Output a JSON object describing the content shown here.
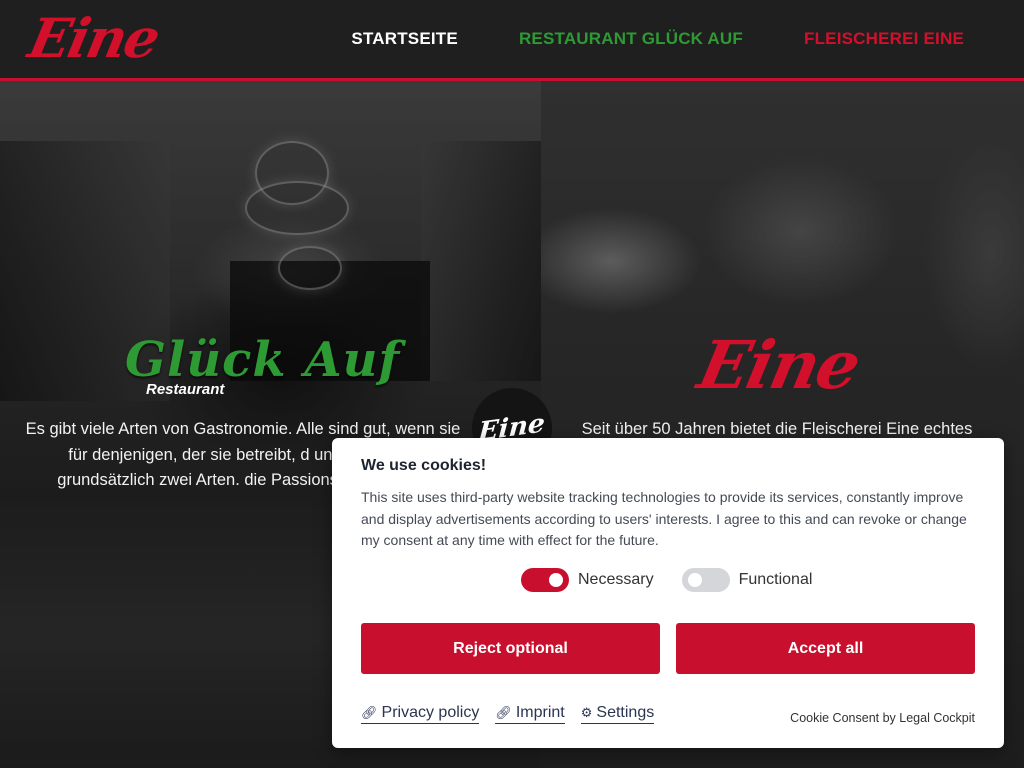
{
  "header": {
    "logo": "Eine",
    "nav": [
      {
        "label": "STARTSEITE",
        "color": "#ffffff"
      },
      {
        "label": "RESTAURANT GLÜCK AUF",
        "color": "#2e9a34"
      },
      {
        "label": "FLEISCHEREI EINE",
        "color": "#d3102b"
      }
    ]
  },
  "left": {
    "title": "Glück Auf",
    "subtitle": "Restaurant",
    "text": "Es gibt viele Arten von Gastronomie. Alle sind gut, wenn sie für denjenigen, der sie betreibt, d unterscheiden grundsätzlich zwei Arten. die Passions-Gastronomi"
  },
  "badge": {
    "logo": "Eine"
  },
  "right": {
    "logo": "Eine",
    "text": "Seit über 50 Jahren bietet die Fleischerei Eine echtes"
  },
  "cookie": {
    "title": "We use cookies!",
    "description": "This site uses third-party website tracking technologies to provide its services, constantly improve and display advertisements according to users' interests. I agree to this and can revoke or change my consent at any time with effect for the future.",
    "toggles": [
      {
        "label": "Necessary",
        "on": true
      },
      {
        "label": "Functional",
        "on": false
      }
    ],
    "reject_label": "Reject optional",
    "accept_label": "Accept all",
    "links": {
      "privacy": "Privacy policy",
      "imprint": "Imprint",
      "settings": "Settings"
    },
    "powered_by": "Cookie Consent by Legal Cockpit"
  },
  "colors": {
    "brand_red": "#c8102e",
    "restaurant_green": "#2e9a34"
  }
}
